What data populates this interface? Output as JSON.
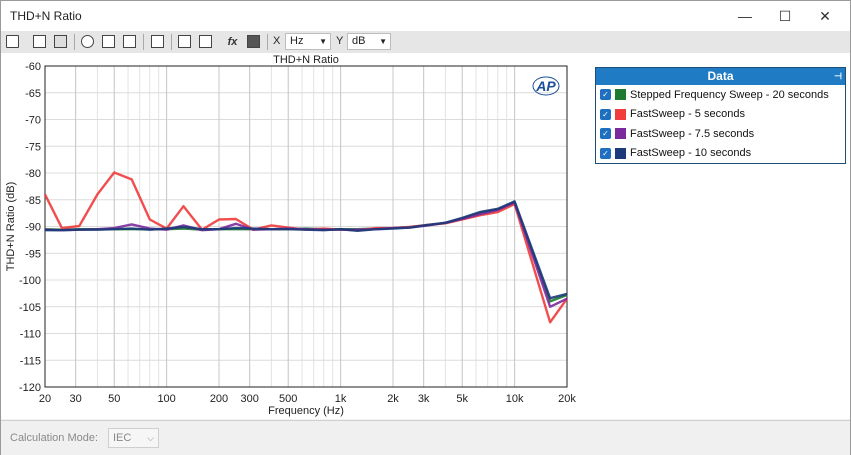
{
  "window": {
    "title": "THD+N Ratio",
    "minimize": "—",
    "maximize": "☐",
    "close": "✕"
  },
  "toolbar": {
    "x_label": "X",
    "x_unit": "Hz",
    "y_label": "Y",
    "y_unit": "dB",
    "fx_label": "fx"
  },
  "legend": {
    "title": "Data",
    "items": [
      {
        "label": "Stepped Frequency Sweep - 20 seconds",
        "color": "#1e7a2e"
      },
      {
        "label": "FastSweep - 5 seconds",
        "color": "#f03c3c"
      },
      {
        "label": "FastSweep - 7.5 seconds",
        "color": "#7b2a9c"
      },
      {
        "label": "FastSweep - 10 seconds",
        "color": "#1b3a7a"
      }
    ]
  },
  "bottom": {
    "calc_label": "Calculation Mode:",
    "calc_value": "IEC"
  },
  "chart_data": {
    "type": "line",
    "title": "THD+N Ratio",
    "xlabel": "Frequency (Hz)",
    "ylabel": "THD+N Ratio (dB)",
    "xscale": "log",
    "xlim": [
      20,
      20000
    ],
    "ylim": [
      -120,
      -60
    ],
    "grid": true,
    "logo": "AP",
    "y_ticks": [
      -60,
      -65,
      -70,
      -75,
      -80,
      -85,
      -90,
      -95,
      -100,
      -105,
      -110,
      -115,
      -120
    ],
    "x_ticks": [
      {
        "value": 20,
        "label": "20"
      },
      {
        "value": 30,
        "label": "30"
      },
      {
        "value": 50,
        "label": "50"
      },
      {
        "value": 100,
        "label": "100"
      },
      {
        "value": 200,
        "label": "200"
      },
      {
        "value": 300,
        "label": "300"
      },
      {
        "value": 500,
        "label": "500"
      },
      {
        "value": 1000,
        "label": "1k"
      },
      {
        "value": 2000,
        "label": "2k"
      },
      {
        "value": 3000,
        "label": "3k"
      },
      {
        "value": 5000,
        "label": "5k"
      },
      {
        "value": 10000,
        "label": "10k"
      },
      {
        "value": 20000,
        "label": "20k"
      }
    ],
    "series": [
      {
        "name": "Stepped Frequency Sweep - 20 seconds",
        "color": "#1e7a2e",
        "x": [
          20,
          25,
          31.5,
          40,
          50,
          63,
          80,
          100,
          125,
          160,
          200,
          250,
          315,
          400,
          500,
          630,
          800,
          1000,
          1250,
          1600,
          2000,
          2500,
          3150,
          4000,
          5000,
          6300,
          8000,
          10000,
          16000,
          20000
        ],
        "y": [
          -90.5,
          -90.6,
          -90.5,
          -90.5,
          -90.5,
          -90.5,
          -90.5,
          -90.5,
          -90.4,
          -90.6,
          -90.5,
          -90.5,
          -90.5,
          -90.5,
          -90.5,
          -90.4,
          -90.5,
          -90.5,
          -90.5,
          -90.4,
          -90.3,
          -90.1,
          -89.8,
          -89.3,
          -88.5,
          -87.5,
          -86.8,
          -85.6,
          -104.0,
          -102.8
        ]
      },
      {
        "name": "FastSweep - 5 seconds",
        "color": "#f03c3c",
        "x": [
          20,
          25,
          31.5,
          40,
          50,
          63,
          80,
          100,
          125,
          160,
          200,
          250,
          315,
          400,
          500,
          630,
          800,
          1000,
          1250,
          1600,
          2000,
          2500,
          3150,
          4000,
          5000,
          6300,
          8000,
          10000,
          16000,
          20000
        ],
        "y": [
          -84.0,
          -90.3,
          -89.9,
          -84.0,
          -79.9,
          -81.2,
          -88.7,
          -90.4,
          -86.2,
          -90.6,
          -88.7,
          -88.6,
          -90.6,
          -89.8,
          -90.2,
          -90.6,
          -90.4,
          -90.6,
          -90.7,
          -90.3,
          -90.3,
          -90.1,
          -89.7,
          -89.4,
          -88.7,
          -87.9,
          -87.3,
          -85.8,
          -107.9,
          -103.5
        ]
      },
      {
        "name": "FastSweep - 7.5 seconds",
        "color": "#7b2a9c",
        "x": [
          20,
          25,
          31.5,
          40,
          50,
          63,
          80,
          100,
          125,
          160,
          200,
          250,
          315,
          400,
          500,
          630,
          800,
          1000,
          1250,
          1600,
          2000,
          2500,
          3150,
          4000,
          5000,
          6300,
          8000,
          10000,
          16000,
          20000
        ],
        "y": [
          -90.6,
          -90.7,
          -90.6,
          -90.5,
          -90.3,
          -89.6,
          -90.4,
          -90.6,
          -89.8,
          -90.7,
          -90.5,
          -89.5,
          -90.6,
          -90.5,
          -90.4,
          -90.5,
          -90.6,
          -90.6,
          -90.6,
          -90.5,
          -90.3,
          -90.2,
          -89.8,
          -89.3,
          -88.6,
          -87.7,
          -86.9,
          -85.5,
          -105.0,
          -103.5
        ]
      },
      {
        "name": "FastSweep - 10 seconds",
        "color": "#1b3a7a",
        "x": [
          20,
          25,
          31.5,
          40,
          50,
          63,
          80,
          100,
          125,
          160,
          200,
          250,
          315,
          400,
          500,
          630,
          800,
          1000,
          1250,
          1600,
          2000,
          2500,
          3150,
          4000,
          5000,
          6300,
          8000,
          10000,
          16000,
          20000
        ],
        "y": [
          -90.7,
          -90.7,
          -90.6,
          -90.6,
          -90.5,
          -90.4,
          -90.6,
          -90.4,
          -90.1,
          -90.5,
          -90.5,
          -90.3,
          -90.4,
          -90.5,
          -90.5,
          -90.6,
          -90.7,
          -90.5,
          -90.8,
          -90.5,
          -90.4,
          -90.2,
          -89.7,
          -89.3,
          -88.4,
          -87.3,
          -86.7,
          -85.3,
          -103.4,
          -102.6
        ]
      }
    ]
  }
}
